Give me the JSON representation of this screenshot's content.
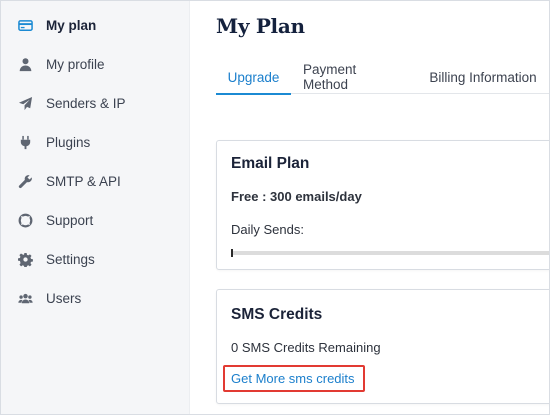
{
  "sidebar": {
    "items": [
      {
        "label": "My plan",
        "icon": "credit-card-icon",
        "active": true
      },
      {
        "label": "My profile",
        "icon": "user-icon"
      },
      {
        "label": "Senders & IP",
        "icon": "paper-plane-icon"
      },
      {
        "label": "Plugins",
        "icon": "plug-icon"
      },
      {
        "label": "SMTP & API",
        "icon": "wrench-icon"
      },
      {
        "label": "Support",
        "icon": "lifebuoy-icon"
      },
      {
        "label": "Settings",
        "icon": "gear-icon"
      },
      {
        "label": "Users",
        "icon": "users-icon"
      }
    ]
  },
  "main": {
    "title": "My Plan",
    "tabs": [
      {
        "label": "Upgrade",
        "active": true
      },
      {
        "label": "Payment Method"
      },
      {
        "label": "Billing Information"
      }
    ],
    "email_plan": {
      "title": "Email Plan",
      "plan_text": "Free : 300 emails/day",
      "daily_sends_label": "Daily Sends:",
      "daily_sends_progress": 0
    },
    "sms_credits": {
      "title": "SMS Credits",
      "remaining_text": "0 SMS Credits Remaining",
      "link_label": "Get More sms credits"
    }
  },
  "colors": {
    "accent": "#1b8ad3",
    "highlight": "#e23a32",
    "sidebar_bg": "#f5f6f8"
  }
}
